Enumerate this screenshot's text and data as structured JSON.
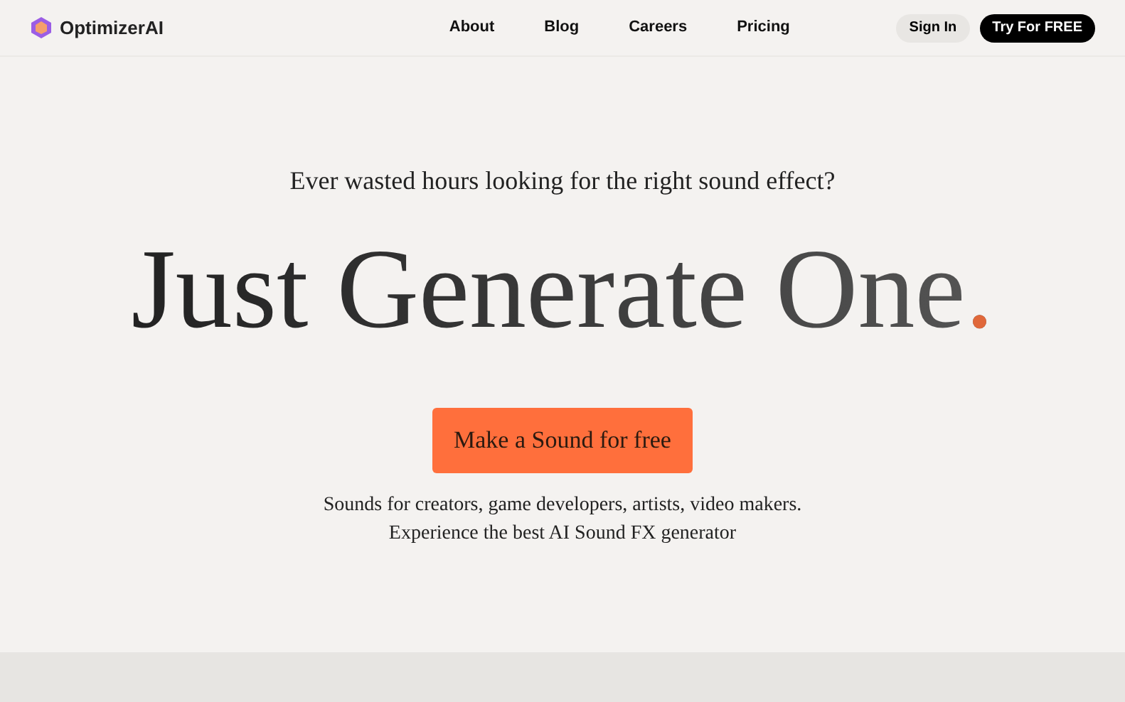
{
  "brand": "OptimizerAI",
  "nav": [
    {
      "label": "About"
    },
    {
      "label": "Blog"
    },
    {
      "label": "Careers"
    },
    {
      "label": "Pricing"
    }
  ],
  "actions": {
    "sign_in": "Sign In",
    "try_free": "Try For FREE"
  },
  "hero": {
    "question": "Ever wasted hours looking for the right sound effect?",
    "headline": "Just Generate One",
    "headline_accent": ".",
    "cta": "Make a Sound for free",
    "subtitle": [
      "Sounds for creators, game developers, artists, video makers.",
      "Experience the best AI Sound FX generator"
    ]
  }
}
